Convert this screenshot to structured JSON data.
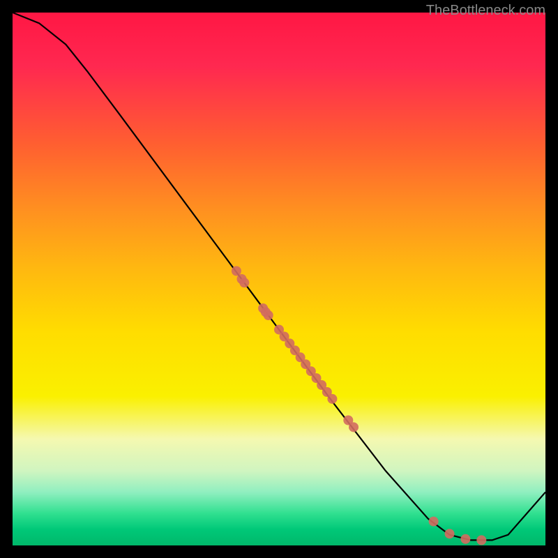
{
  "watermark": "TheBottleneck.com",
  "chart_data": {
    "type": "line",
    "title": "",
    "xlabel": "",
    "ylabel": "",
    "xlim": [
      0,
      100
    ],
    "ylim": [
      0,
      100
    ],
    "curve": [
      {
        "x": 0,
        "y": 100
      },
      {
        "x": 5,
        "y": 98
      },
      {
        "x": 10,
        "y": 94
      },
      {
        "x": 14,
        "y": 89
      },
      {
        "x": 20,
        "y": 81
      },
      {
        "x": 30,
        "y": 67.5
      },
      {
        "x": 40,
        "y": 54
      },
      {
        "x": 50,
        "y": 40.5
      },
      {
        "x": 60,
        "y": 27
      },
      {
        "x": 70,
        "y": 14
      },
      {
        "x": 78,
        "y": 5
      },
      {
        "x": 82,
        "y": 2
      },
      {
        "x": 86,
        "y": 1
      },
      {
        "x": 90,
        "y": 1
      },
      {
        "x": 93,
        "y": 2
      },
      {
        "x": 100,
        "y": 10
      }
    ],
    "points": [
      {
        "x": 42,
        "y": 51.5
      },
      {
        "x": 43,
        "y": 50
      },
      {
        "x": 43.5,
        "y": 49.3
      },
      {
        "x": 47,
        "y": 44.5
      },
      {
        "x": 47.5,
        "y": 43.8
      },
      {
        "x": 48,
        "y": 43.2
      },
      {
        "x": 50,
        "y": 40.5
      },
      {
        "x": 51,
        "y": 39.2
      },
      {
        "x": 52,
        "y": 37.9
      },
      {
        "x": 53,
        "y": 36.6
      },
      {
        "x": 54,
        "y": 35.3
      },
      {
        "x": 55,
        "y": 34
      },
      {
        "x": 56,
        "y": 32.7
      },
      {
        "x": 57,
        "y": 31.4
      },
      {
        "x": 58,
        "y": 30.1
      },
      {
        "x": 59,
        "y": 28.8
      },
      {
        "x": 60,
        "y": 27.5
      },
      {
        "x": 63,
        "y": 23.5
      },
      {
        "x": 64,
        "y": 22.2
      },
      {
        "x": 79,
        "y": 4.5
      },
      {
        "x": 82,
        "y": 2.2
      },
      {
        "x": 85,
        "y": 1.2
      },
      {
        "x": 88,
        "y": 1
      }
    ],
    "point_color": "#d16b5f",
    "curve_color": "#000000"
  }
}
